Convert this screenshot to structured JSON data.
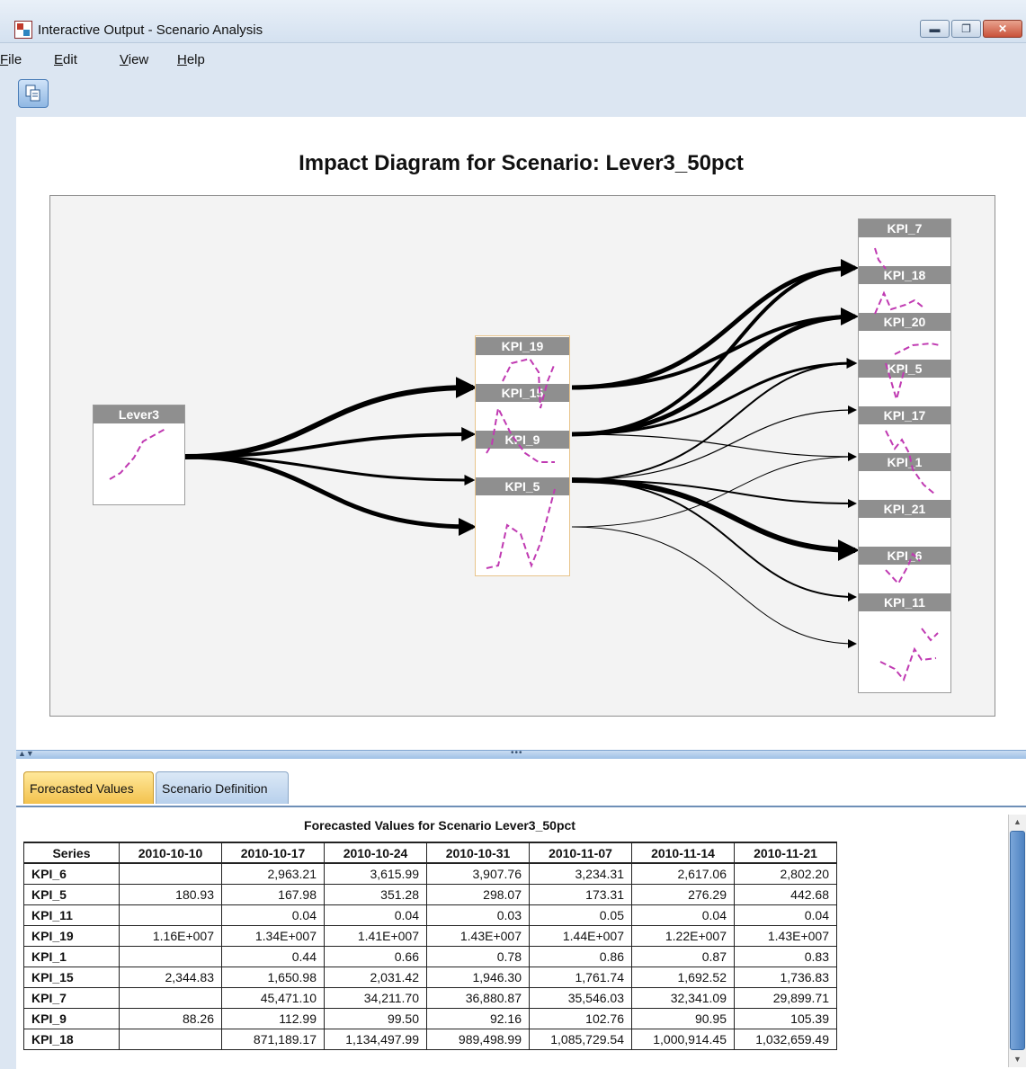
{
  "window": {
    "title": "Interactive Output - Scenario Analysis",
    "minimize_glyph": "▬",
    "maximize_glyph": "❐",
    "close_glyph": "✕"
  },
  "menu": {
    "items": [
      {
        "label": "File",
        "mnemonic": "F",
        "rest": "ile"
      },
      {
        "label": "Edit",
        "mnemonic": "E",
        "rest": "dit"
      },
      {
        "label": "View",
        "mnemonic": "V",
        "rest": "iew"
      },
      {
        "label": "Help",
        "mnemonic": "H",
        "rest": "elp"
      }
    ]
  },
  "toolbar": {
    "copy_icon": "copy-icon"
  },
  "diagram": {
    "title": "Impact Diagram for Scenario: Lever3_50pct",
    "source": "Lever3",
    "middle_nodes": [
      "KPI_19",
      "KPI_15",
      "KPI_9",
      "KPI_5"
    ],
    "right_nodes": [
      "KPI_7",
      "KPI_18",
      "KPI_20",
      "KPI_5",
      "KPI_17",
      "KPI_1",
      "KPI_21",
      "KPI_6",
      "KPI_11"
    ],
    "line_color": "#c03ab2"
  },
  "tabs": {
    "active": "Forecasted Values",
    "inactive": "Scenario Definition"
  },
  "table": {
    "caption": "Forecasted Values for Scenario Lever3_50pct",
    "series_header": "Series",
    "columns": [
      "2010-10-10",
      "2010-10-17",
      "2010-10-24",
      "2010-10-31",
      "2010-11-07",
      "2010-11-14",
      "2010-11-21"
    ],
    "rows": [
      {
        "series": "KPI_6",
        "values": [
          "",
          "2,963.21",
          "3,615.99",
          "3,907.76",
          "3,234.31",
          "2,617.06",
          "2,802.20"
        ]
      },
      {
        "series": "KPI_5",
        "values": [
          "180.93",
          "167.98",
          "351.28",
          "298.07",
          "173.31",
          "276.29",
          "442.68"
        ]
      },
      {
        "series": "KPI_11",
        "values": [
          "",
          "0.04",
          "0.04",
          "0.03",
          "0.05",
          "0.04",
          "0.04"
        ]
      },
      {
        "series": "KPI_19",
        "values": [
          "1.16E+007",
          "1.34E+007",
          "1.41E+007",
          "1.43E+007",
          "1.44E+007",
          "1.22E+007",
          "1.43E+007"
        ]
      },
      {
        "series": "KPI_1",
        "values": [
          "",
          "0.44",
          "0.66",
          "0.78",
          "0.86",
          "0.87",
          "0.83"
        ]
      },
      {
        "series": "KPI_15",
        "values": [
          "2,344.83",
          "1,650.98",
          "2,031.42",
          "1,946.30",
          "1,761.74",
          "1,692.52",
          "1,736.83"
        ]
      },
      {
        "series": "KPI_7",
        "values": [
          "",
          "45,471.10",
          "34,211.70",
          "36,880.87",
          "35,546.03",
          "32,341.09",
          "29,899.71"
        ]
      },
      {
        "series": "KPI_9",
        "values": [
          "88.26",
          "112.99",
          "99.50",
          "92.16",
          "102.76",
          "90.95",
          "105.39"
        ]
      },
      {
        "series": "KPI_18",
        "values": [
          "",
          "871,189.17",
          "1,134,497.99",
          "989,498.99",
          "1,085,729.54",
          "1,000,914.45",
          "1,032,659.49"
        ]
      }
    ]
  }
}
